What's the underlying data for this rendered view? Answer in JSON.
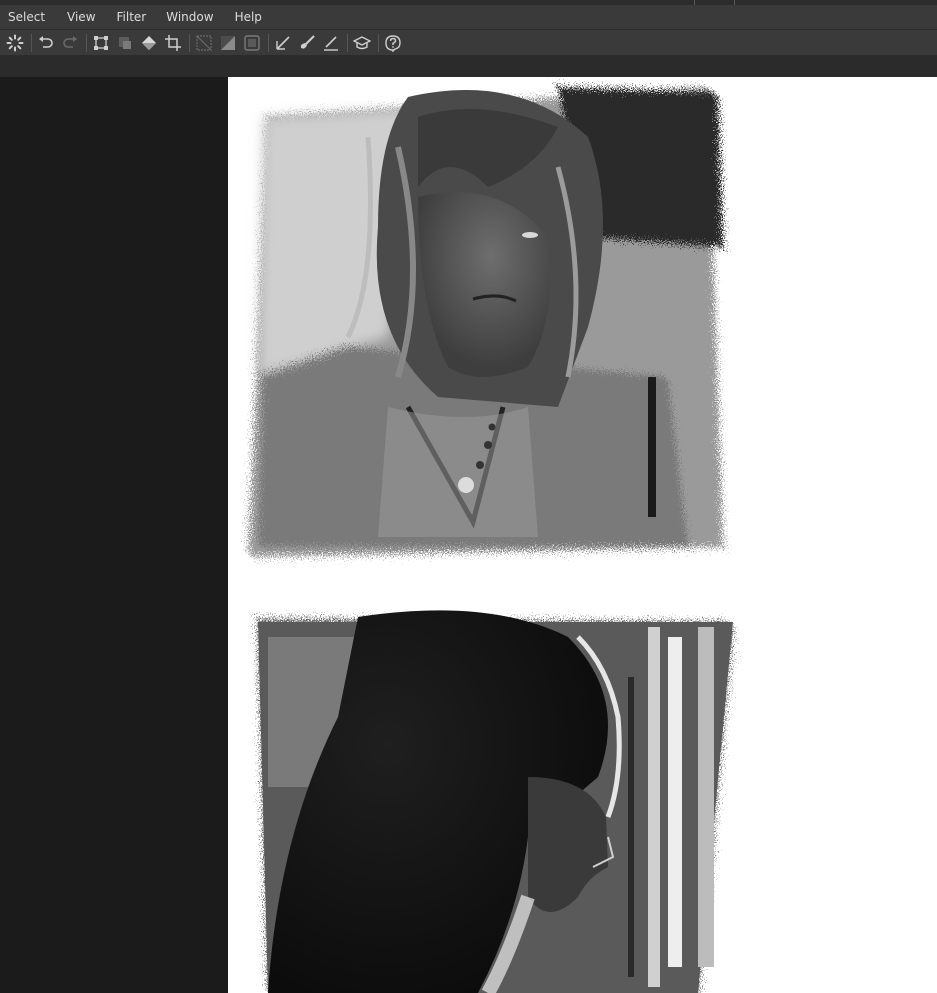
{
  "menubar": {
    "items": [
      "Select",
      "View",
      "Filter",
      "Window",
      "Help"
    ]
  },
  "toolbar": {
    "tools": [
      {
        "name": "loading-spinner-icon",
        "label": "Processing"
      },
      {
        "name": "undo-icon",
        "label": "Undo"
      },
      {
        "name": "redo-icon",
        "label": "Redo"
      },
      {
        "name": "transform-icon",
        "label": "Transform"
      },
      {
        "name": "selection-mask-icon",
        "label": "Selection"
      },
      {
        "name": "fill-bucket-icon",
        "label": "Fill"
      },
      {
        "name": "crop-icon",
        "label": "Crop"
      },
      {
        "name": "gradient-icon",
        "label": "Gradient"
      },
      {
        "name": "gradient-fill-icon",
        "label": "Gradient Fill"
      },
      {
        "name": "frame-icon",
        "label": "Frame"
      },
      {
        "name": "ruler-icon",
        "label": "Ruler"
      },
      {
        "name": "brush-icon",
        "label": "Brush"
      },
      {
        "name": "eraser-line-icon",
        "label": "Line"
      },
      {
        "name": "tutorial-cap-icon",
        "label": "Tutorial"
      },
      {
        "name": "help-icon",
        "label": "Help"
      }
    ]
  },
  "colors": {
    "menubar": "#3a3a3a",
    "toolbar": "#3a3a3a",
    "workspace": "#1b1b1b",
    "artboard": "#ffffff",
    "icon": "#cfcfcf"
  }
}
